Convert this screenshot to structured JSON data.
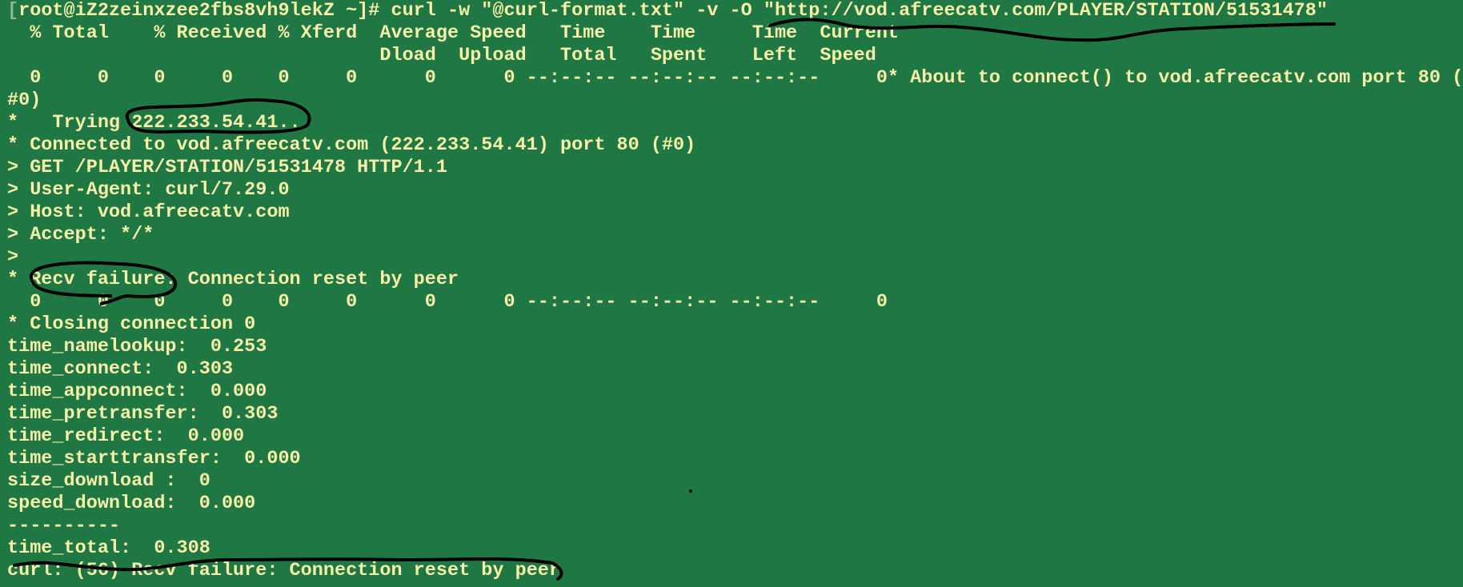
{
  "terminal": {
    "prompt_bracket": "[",
    "lines": [
      "root@iZ2zeinxzee2fbs8vh9lekZ ~]# curl -w \"@curl-format.txt\" -v -O \"http://vod.afreecatv.com/PLAYER/STATION/51531478\"",
      "  % Total    % Received % Xferd  Average Speed   Time    Time     Time  Current",
      "                                 Dload  Upload   Total   Spent    Left  Speed",
      "  0     0    0     0    0     0      0      0 --:--:-- --:--:-- --:--:--     0* About to connect() to vod.afreecatv.com port 80 (",
      "#0)",
      "*   Trying 222.233.54.41..",
      "* Connected to vod.afreecatv.com (222.233.54.41) port 80 (#0)",
      "> GET /PLAYER/STATION/51531478 HTTP/1.1",
      "> User-Agent: curl/7.29.0",
      "> Host: vod.afreecatv.com",
      "> Accept: */*",
      ">",
      "* Recv failure: Connection reset by peer",
      "  0     0    0     0    0     0      0      0 --:--:-- --:--:-- --:--:--     0",
      "* Closing connection 0",
      "time_namelookup:  0.253",
      "time_connect:  0.303",
      "time_appconnect:  0.000",
      "time_pretransfer:  0.303",
      "time_redirect:  0.000",
      "time_starttransfer:  0.000",
      "size_download :  0",
      "speed_download:  0.000",
      "----------",
      "time_total:  0.308",
      "curl: (56) Recv failure: Connection reset by peer"
    ]
  },
  "colors": {
    "background": "#1f7743",
    "text": "#f7f0a8",
    "annotation": "#000000"
  }
}
